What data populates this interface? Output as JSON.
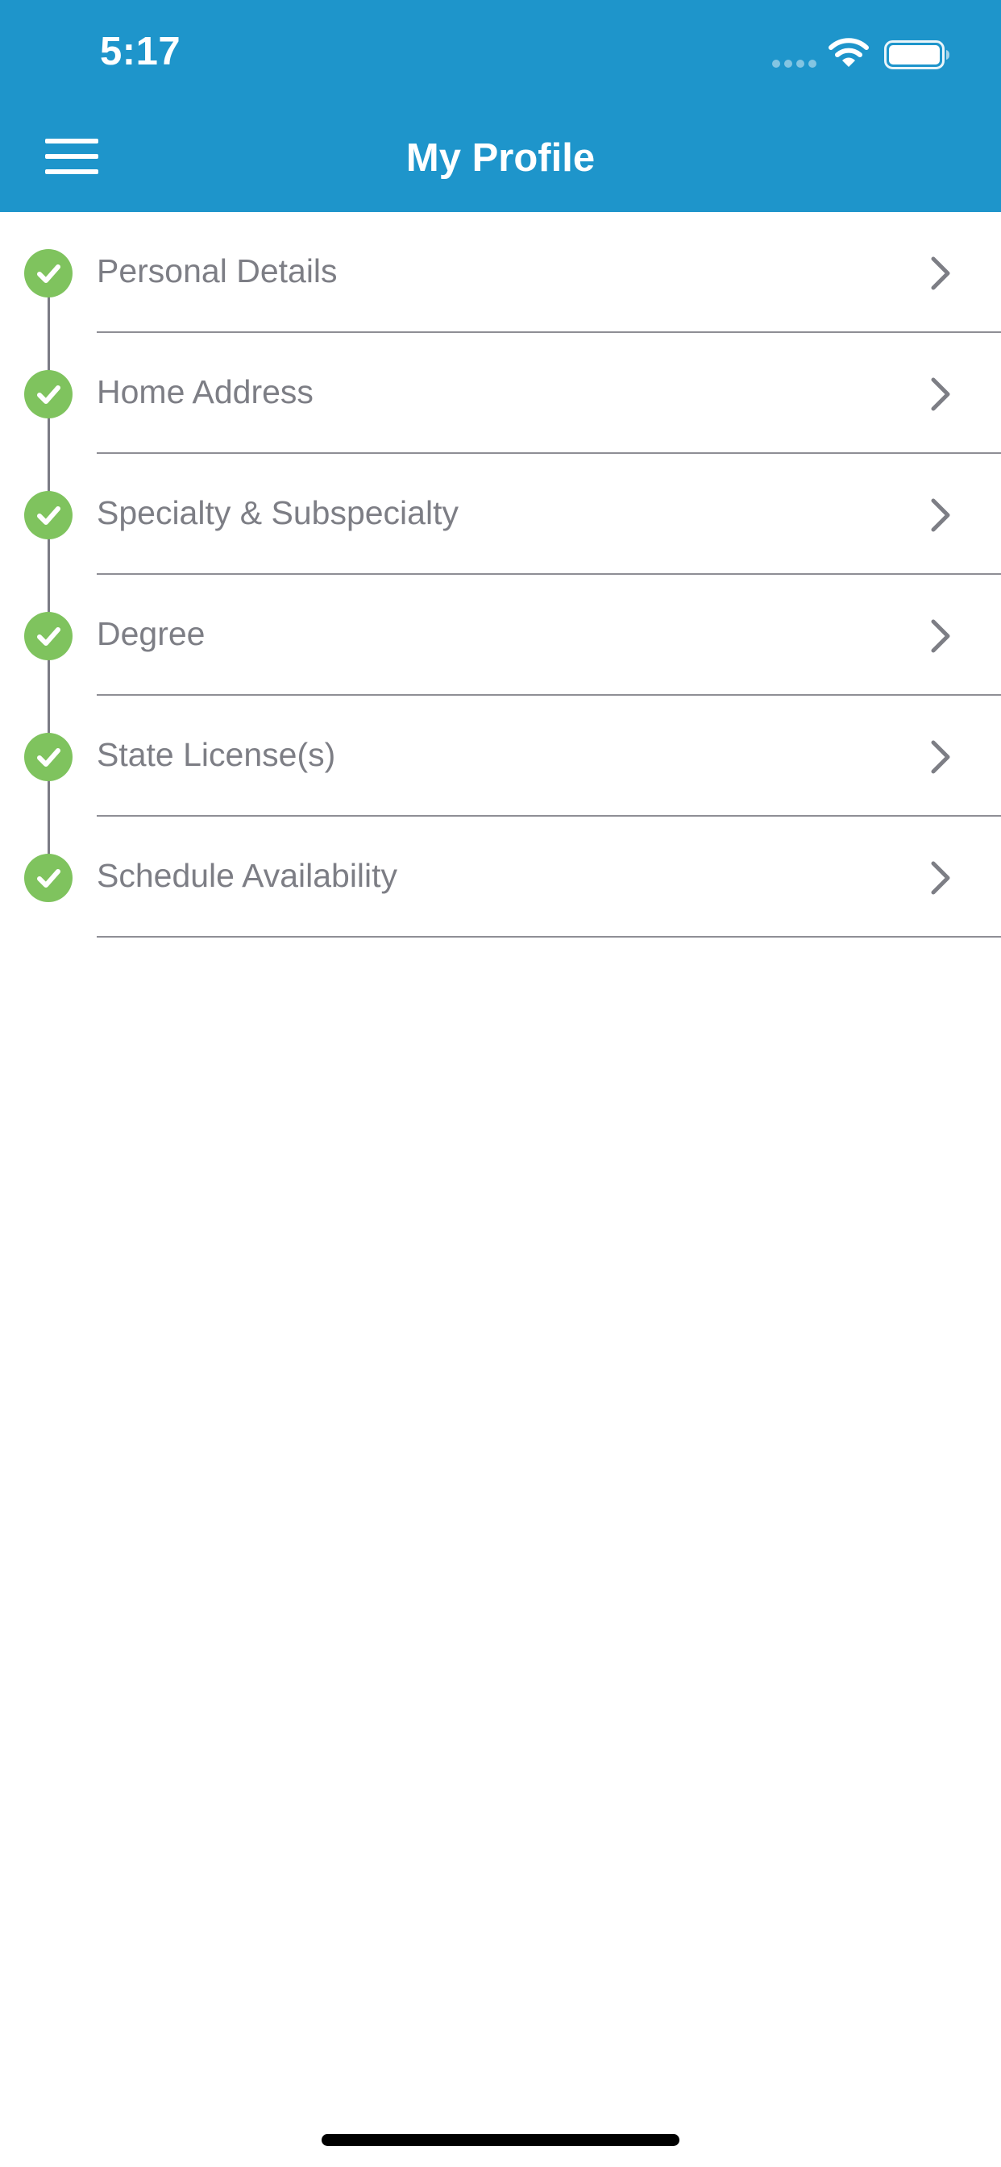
{
  "status_bar": {
    "time": "5:17",
    "wifi_icon": "wifi-icon",
    "battery_icon": "battery-icon"
  },
  "header": {
    "title": "My Profile",
    "menu_icon": "hamburger-menu-icon",
    "background_color": "#1E95CB"
  },
  "profile_sections": [
    {
      "label": "Personal Details",
      "status": "complete"
    },
    {
      "label": "Home Address",
      "status": "complete"
    },
    {
      "label": "Specialty & Subspecialty",
      "status": "complete"
    },
    {
      "label": "Degree",
      "status": "complete"
    },
    {
      "label": "State License(s)",
      "status": "complete"
    },
    {
      "label": "Schedule Availability",
      "status": "complete"
    }
  ],
  "colors": {
    "complete_badge": "#7FC35E",
    "label_text": "#7D7E85"
  }
}
